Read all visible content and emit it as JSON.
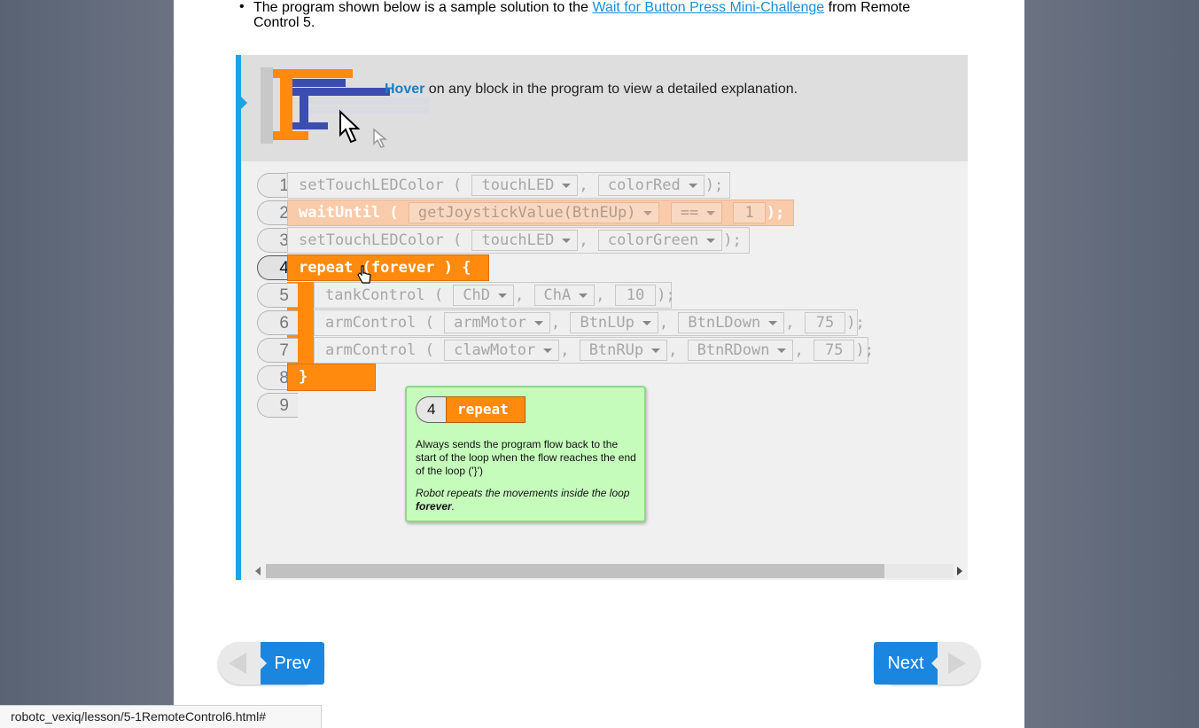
{
  "lesson": {
    "bullet_prefix": "The program shown below is a sample solution to the",
    "bullet_link": "Wait for Button Press Mini-Challenge",
    "bullet_suffix": " from Remote Control 5."
  },
  "banner": {
    "hover_word": "Hover",
    "hover_rest": " on any block in the program to view a detailed explanation."
  },
  "code_lines": [
    {
      "num": "1",
      "func": "setTouchLEDColor (",
      "args": [
        "touchLED",
        "colorRed"
      ],
      "end": ");"
    },
    {
      "num": "2",
      "func": "waitUntil (",
      "args": [
        "getJoystickValue(BtnEUp)",
        "==",
        "1"
      ],
      "end": ");"
    },
    {
      "num": "3",
      "func": "setTouchLEDColor (",
      "args": [
        "touchLED",
        "colorGreen"
      ],
      "end": ");"
    },
    {
      "num": "4",
      "func": "repeat (forever ) {"
    },
    {
      "num": "5",
      "func": "tankControl (",
      "args": [
        "ChD",
        "ChA",
        "10"
      ],
      "end": ");"
    },
    {
      "num": "6",
      "func": "armControl (",
      "args": [
        "armMotor",
        "BtnLUp",
        "BtnLDown",
        "75"
      ],
      "end": ");"
    },
    {
      "num": "7",
      "func": "armControl (",
      "args": [
        "clawMotor",
        "BtnRUp",
        "BtnRDown",
        "75"
      ],
      "end": ");"
    },
    {
      "num": "8",
      "func": "}"
    },
    {
      "num": "9"
    }
  ],
  "tooltip": {
    "line_num": "4",
    "block": "repeat",
    "description": "Always sends the program flow back to the start of the loop when the flow reaches the end of the loop ('}')",
    "note_prefix": "Robot repeats the movements inside the loop ",
    "note_bold": "forever",
    "note_suffix": "."
  },
  "nav": {
    "prev_label": "Prev",
    "next_label": "Next"
  },
  "status_url": "robotc_vexiq/lesson/5-1RemoteControl6.html#",
  "colors": {
    "accent_blue": "#1b86e0",
    "block_orange": "#ff8a0e",
    "tooltip_green": "#c5fcbc"
  }
}
